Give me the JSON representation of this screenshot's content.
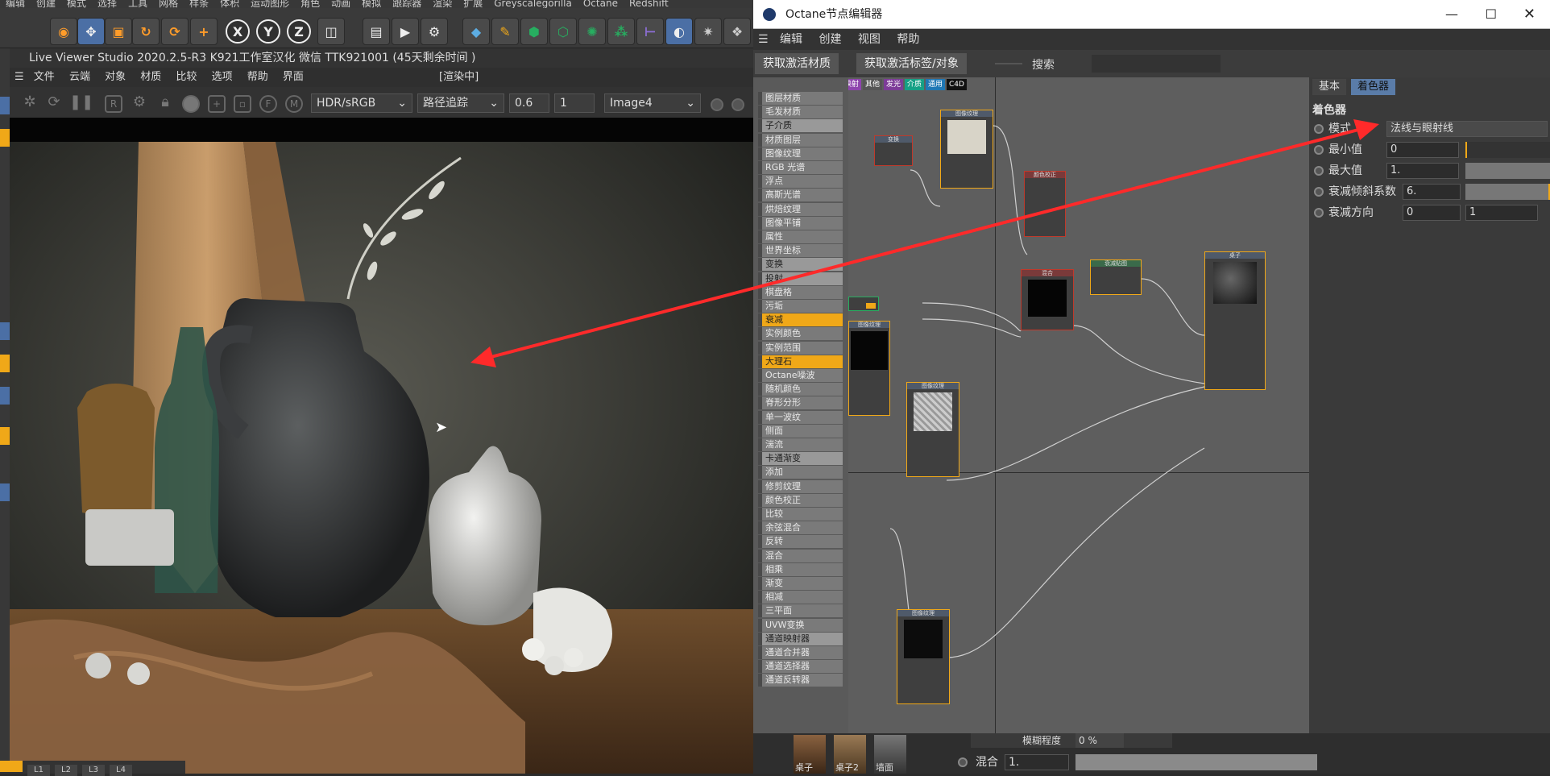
{
  "c4d": {
    "menu": [
      "编辑",
      "创建",
      "模式",
      "选择",
      "工具",
      "网格",
      "样条",
      "体积",
      "运动图形",
      "角色",
      "动画",
      "模拟",
      "跟踪器",
      "渲染",
      "扩展",
      "Greyscalegorilla",
      "Octane",
      "Redshift"
    ],
    "axis_labels": [
      "X",
      "Y",
      "Z"
    ]
  },
  "viewer": {
    "title": "Live Viewer Studio 2020.2.5-R3  K921工作室汉化  微信  TTK921001  (45天剩余时间 )",
    "menu": [
      "文件",
      "云端",
      "对象",
      "材质",
      "比较",
      "选项",
      "帮助",
      "界面"
    ],
    "status": "[渲染中]",
    "colorspace": "HDR/sRGB",
    "kernel": "路径追踪",
    "value1": "0.6",
    "value2": "1",
    "image": "Image4",
    "bottom_tabs": [
      "",
      "L1",
      "L2",
      "L3",
      "L4"
    ]
  },
  "octane": {
    "title": "Octane节点编辑器",
    "menu": [
      "编辑",
      "创建",
      "视图",
      "帮助"
    ],
    "btn_get_material": "获取激活材质",
    "btn_get_tag": "获取激活标签/对象",
    "search_label": "搜索",
    "categories": [
      {
        "label": "材质",
        "color": "#c0392b"
      },
      {
        "label": "纹理",
        "color": "#2e86c1"
      },
      {
        "label": "生成",
        "color": "#27ae60"
      },
      {
        "label": "OSL",
        "color": "#2c3e91"
      },
      {
        "label": "映射",
        "color": "#8e44ad"
      },
      {
        "label": "其他",
        "color": "#555555"
      },
      {
        "label": "发光",
        "color": "#7d3c98"
      },
      {
        "label": "介质",
        "color": "#16a085"
      },
      {
        "label": "通用",
        "color": "#1f77b4"
      },
      {
        "label": "C4D",
        "color": "#111111"
      }
    ],
    "node_list": [
      {
        "label": "图层材质",
        "type": "normal"
      },
      {
        "label": "毛发材质",
        "type": "normal"
      },
      {
        "label": "子介质",
        "type": "sep"
      },
      {
        "label": "材质图层",
        "type": "normal"
      },
      {
        "label": "图像纹理",
        "type": "normal"
      },
      {
        "label": "RGB 光谱",
        "type": "normal"
      },
      {
        "label": "浮点",
        "type": "normal"
      },
      {
        "label": "高斯光谱",
        "type": "normal"
      },
      {
        "label": "烘焙纹理",
        "type": "normal"
      },
      {
        "label": "图像平铺",
        "type": "normal"
      },
      {
        "label": "属性",
        "type": "normal"
      },
      {
        "label": "世界坐标",
        "type": "normal"
      },
      {
        "label": "变换",
        "type": "sep"
      },
      {
        "label": "投射",
        "type": "sep"
      },
      {
        "label": "棋盘格",
        "type": "normal"
      },
      {
        "label": "污垢",
        "type": "normal"
      },
      {
        "label": "衰减",
        "type": "hl"
      },
      {
        "label": "实例颜色",
        "type": "normal"
      },
      {
        "label": "实例范围",
        "type": "normal"
      },
      {
        "label": "大理石",
        "type": "hl"
      },
      {
        "label": "Octane噪波",
        "type": "normal"
      },
      {
        "label": "随机颜色",
        "type": "normal"
      },
      {
        "label": "脊形分形",
        "type": "normal"
      },
      {
        "label": "单一波纹",
        "type": "normal"
      },
      {
        "label": "侧面",
        "type": "normal"
      },
      {
        "label": "湍流",
        "type": "normal"
      },
      {
        "label": "卡通渐变",
        "type": "sep"
      },
      {
        "label": "添加",
        "type": "normal"
      },
      {
        "label": "修剪纹理",
        "type": "normal"
      },
      {
        "label": "颜色校正",
        "type": "normal"
      },
      {
        "label": "比较",
        "type": "normal"
      },
      {
        "label": "余弦混合",
        "type": "normal"
      },
      {
        "label": "反转",
        "type": "normal"
      },
      {
        "label": "混合",
        "type": "normal"
      },
      {
        "label": "相乘",
        "type": "normal"
      },
      {
        "label": "渐变",
        "type": "normal"
      },
      {
        "label": "相减",
        "type": "normal"
      },
      {
        "label": "三平面",
        "type": "normal"
      },
      {
        "label": "UVW变换",
        "type": "normal"
      },
      {
        "label": "通道映射器",
        "type": "sep"
      },
      {
        "label": "通道合并器",
        "type": "normal"
      },
      {
        "label": "通道选择器",
        "type": "normal"
      },
      {
        "label": "通道反转器",
        "type": "normal"
      }
    ],
    "node_titles": {
      "tex1": "图像纹理",
      "transform": "变换",
      "colorcorr": "颜色校正",
      "rgb": "RGB 颜色",
      "tex2": "图像纹理",
      "mix": "混合",
      "falloff": "衰减贴图",
      "material": "桌子",
      "tex3": "图像纹理",
      "tex4": "图像纹理"
    },
    "props": {
      "tab_basic": "基本",
      "tab_shader": "着色器",
      "heading": "着色器",
      "rows": [
        {
          "label": "模式",
          "value": "法线与眼射线"
        },
        {
          "label": "最小值",
          "value": "0"
        },
        {
          "label": "最大值",
          "value": "1."
        },
        {
          "label": "衰减倾斜系数",
          "value": "6."
        },
        {
          "label": "衰减方向",
          "value": "0",
          "value2": "1"
        }
      ]
    },
    "bottom": {
      "blend_label": "混合",
      "blend_value": "1.",
      "blur_label": "模糊程度",
      "blur_value": "0 %",
      "materials": [
        "桌子",
        "桌子2",
        "墙面"
      ]
    }
  }
}
